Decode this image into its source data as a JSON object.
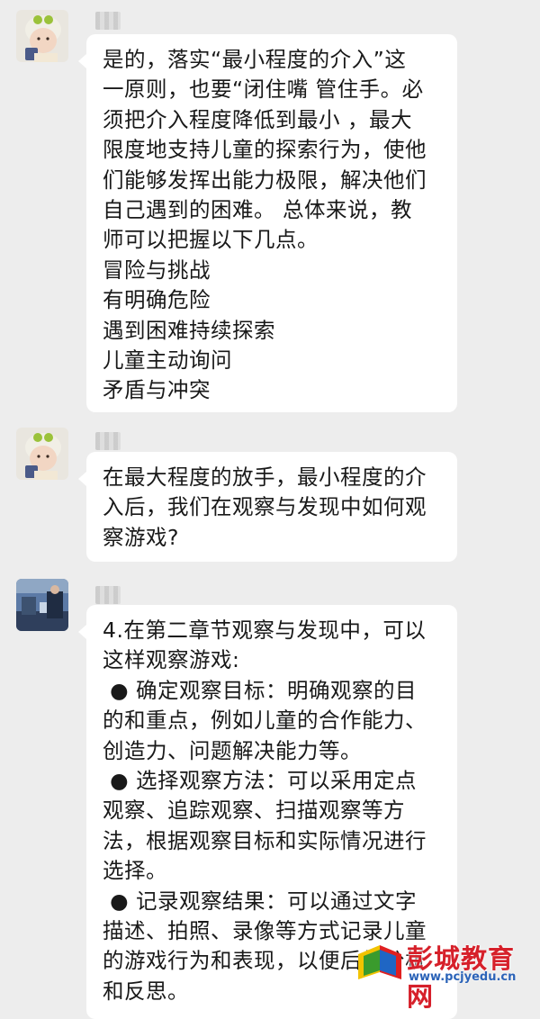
{
  "messages": [
    {
      "lines": [
        "是的，落实“最小程度的介入”这",
        "一原则，也要“闭住嘴 管住手。必",
        "须把介入程度降低到最小 ，最大",
        "限度地支持儿童的探索行为，使他",
        "们能够发挥出能力极限，解决他们",
        "自己遇到的困难。 总体来说，教",
        "师可以把握以下几点。",
        "冒险与挑战",
        "有明确危险",
        "遇到困难持续探索",
        "儿童主动询问",
        "矛盾与冲突"
      ]
    },
    {
      "lines": [
        "在最大程度的放手，最小程度的介",
        "入后，我们在观察与发现中如何观",
        "察游戏?"
      ]
    },
    {
      "lines": [
        "4.在第二章节观察与发现中，可以",
        "这样观察游戏:",
        " ● 确定观察目标：明确观察的目",
        "的和重点，例如儿童的合作能力、",
        "创造力、问题解决能力等。",
        " ● 选择观察方法：可以采用定点",
        "观察、追踪观察、扫描观察等方",
        "法，根据观察目标和实际情况进行",
        "选择。",
        " ● 记录观察结果：可以通过文字",
        "描述、拍照、录像等方式记录儿童",
        "的游戏行为和表现，以便后续分析",
        "和反思。"
      ]
    }
  ],
  "watermark": {
    "title": "彭城教育网",
    "url": "www.pcjyedu.cn"
  }
}
